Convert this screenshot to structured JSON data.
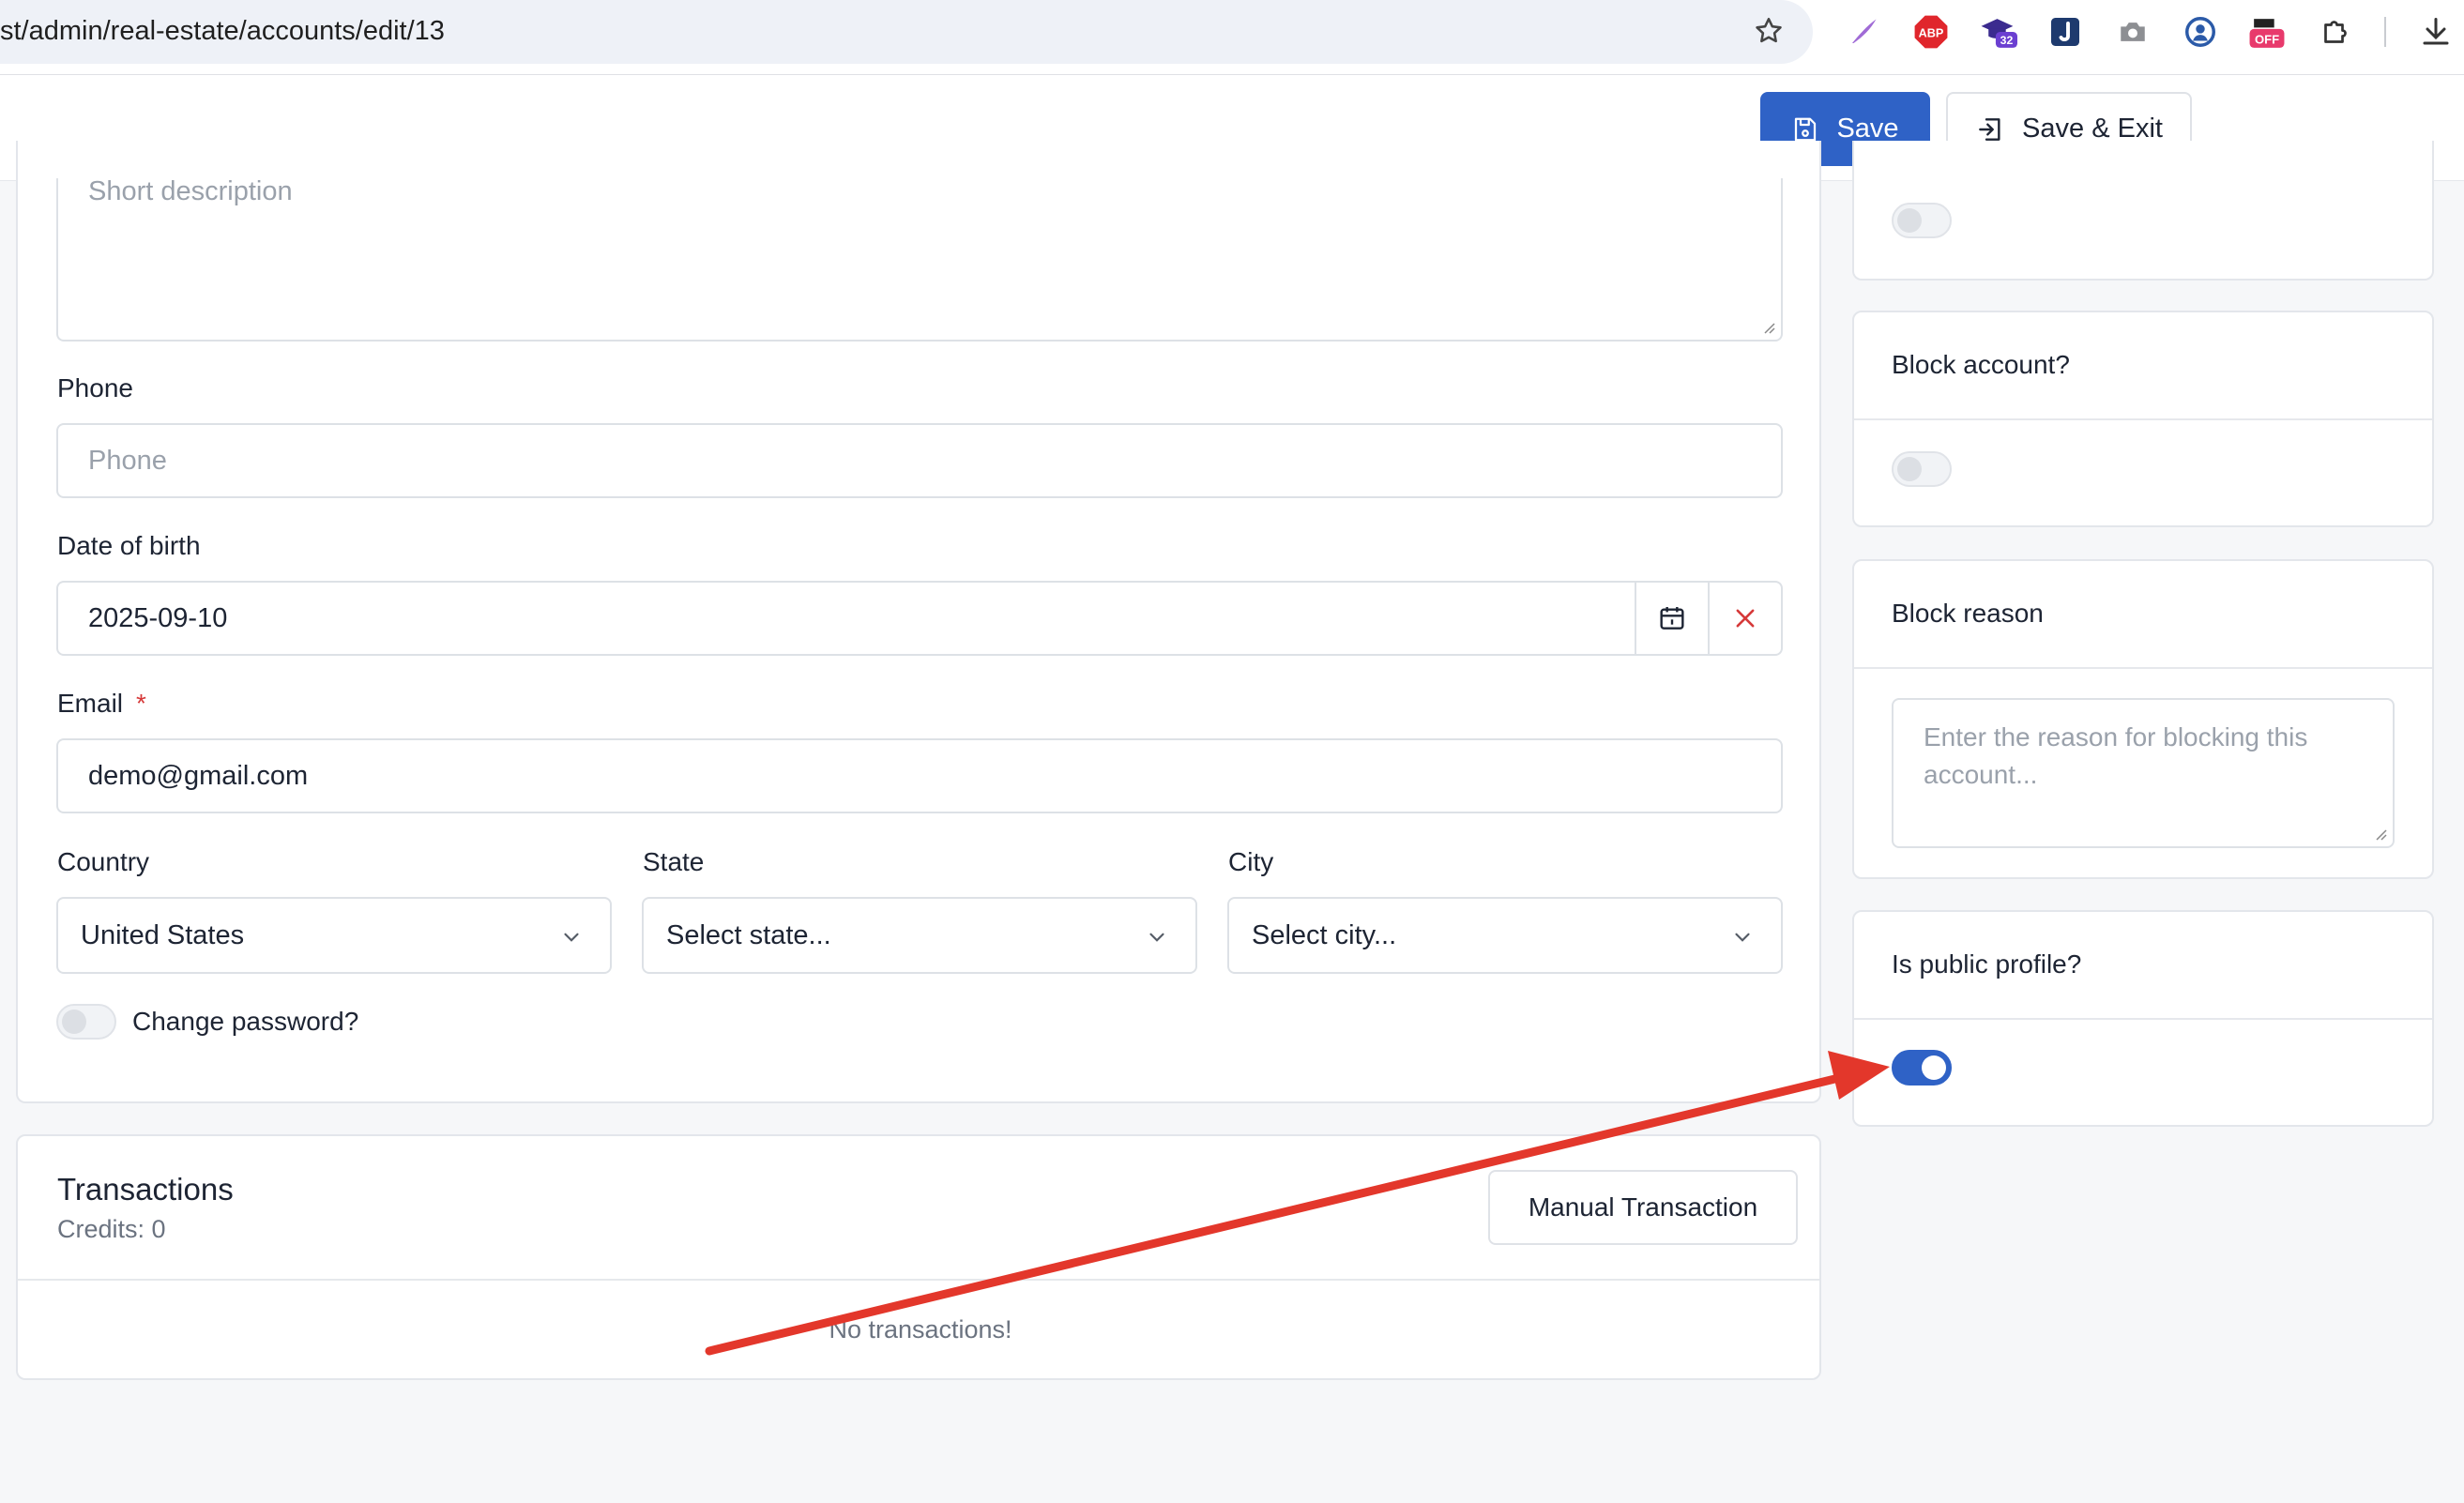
{
  "browser": {
    "url": "st/admin/real-estate/accounts/edit/13",
    "extensions": [
      "quill-icon",
      "adblock-plus-icon",
      "graduation-cap-extension-icon",
      "j-extension-icon",
      "camera-icon",
      "user-lookup-icon",
      "off-extension-icon",
      "puzzle-piece-icon",
      "download-icon"
    ],
    "ext_badge_count": "32",
    "ext_abp_label": "ABP",
    "ext_off_label": "OFF"
  },
  "toolbar": {
    "save_label": "Save",
    "save_exit_label": "Save & Exit"
  },
  "form": {
    "description_placeholder": "Short description",
    "phone_label": "Phone",
    "phone_placeholder": "Phone",
    "dob_label": "Date of birth",
    "dob_value": "2025-09-10",
    "email_label": "Email",
    "email_required_mark": "*",
    "email_value": "demo@gmail.com",
    "country_label": "Country",
    "country_value": "United States",
    "state_label": "State",
    "state_value": "Select state...",
    "city_label": "City",
    "city_value": "Select city...",
    "change_password_label": "Change password?",
    "change_password_on": false
  },
  "transactions": {
    "title": "Transactions",
    "credits": "Credits: 0",
    "manual_button": "Manual Transaction",
    "empty_text": "No transactions!"
  },
  "sidebar": {
    "top_toggle_on": false,
    "block_account_title": "Block account?",
    "block_account_on": false,
    "block_reason_title": "Block reason",
    "block_reason_placeholder": "Enter the reason for blocking this account...",
    "public_profile_title": "Is public profile?",
    "public_profile_on": true
  },
  "colors": {
    "primary": "#2f62c6",
    "annotation_arrow": "#e3372b",
    "required": "#d63939"
  }
}
